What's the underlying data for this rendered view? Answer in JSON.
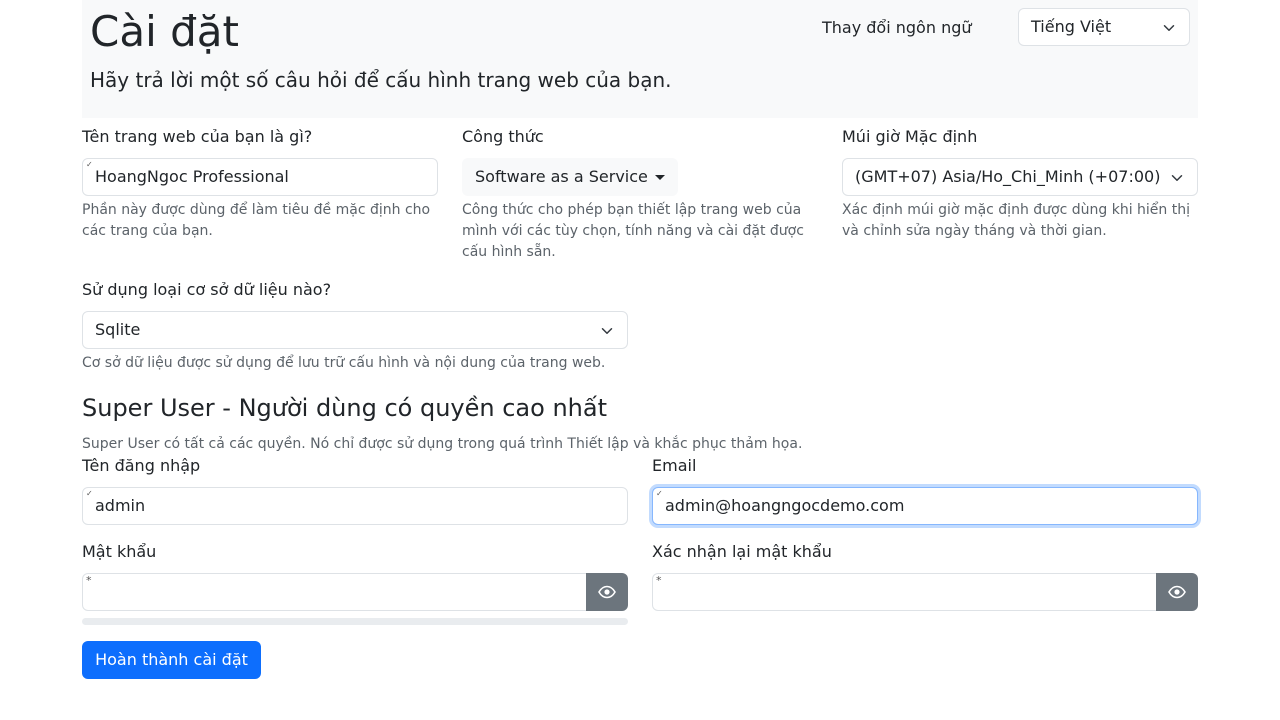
{
  "header": {
    "title": "Cài đặt",
    "subtitle": "Hãy trả lời một số câu hỏi để cấu hình trang web của bạn.",
    "language_label": "Thay đổi ngôn ngữ",
    "language_value": "Tiếng Việt"
  },
  "site_name": {
    "label": "Tên trang web của bạn là gì?",
    "value": "HoangNgoc Professional",
    "help": "Phần này được dùng để làm tiêu đề mặc định cho các trang của bạn."
  },
  "recipe": {
    "label": "Công thức",
    "value": "Software as a Service",
    "help": "Công thức cho phép bạn thiết lập trang web của mình với các tùy chọn, tính năng và cài đặt được cấu hình sẵn."
  },
  "timezone": {
    "label": "Múi giờ Mặc định",
    "value": "(GMT+07) Asia/Ho_Chi_Minh (+07:00)",
    "help": "Xác định múi giờ mặc định được dùng khi hiển thị và chỉnh sửa ngày tháng và thời gian."
  },
  "database": {
    "label": "Sử dụng loại cơ sở dữ liệu nào?",
    "value": "Sqlite",
    "help": "Cơ sở dữ liệu được sử dụng để lưu trữ cấu hình và nội dung của trang web."
  },
  "super_user": {
    "title": "Super User - Người dùng có quyền cao nhất",
    "description": "Super User có tất cả các quyền. Nó chỉ được sử dụng trong quá trình Thiết lập và khắc phục thảm họa.",
    "username_label": "Tên đăng nhập",
    "username_value": "admin",
    "email_label": "Email",
    "email_value": "admin@hoangngocdemo.com",
    "password_label": "Mật khẩu",
    "password_value": "",
    "confirm_label": "Xác nhận lại mật khẩu",
    "confirm_value": "",
    "password_strength": 0
  },
  "submit_label": "Hoàn thành cài đặt",
  "icons": {
    "autofill": "*",
    "eye": "eye-icon",
    "chevron": "chevron-down-icon"
  },
  "colors": {
    "primary": "#0d6efd",
    "secondary": "#6c757d",
    "header_bg": "#f8f9fa"
  }
}
